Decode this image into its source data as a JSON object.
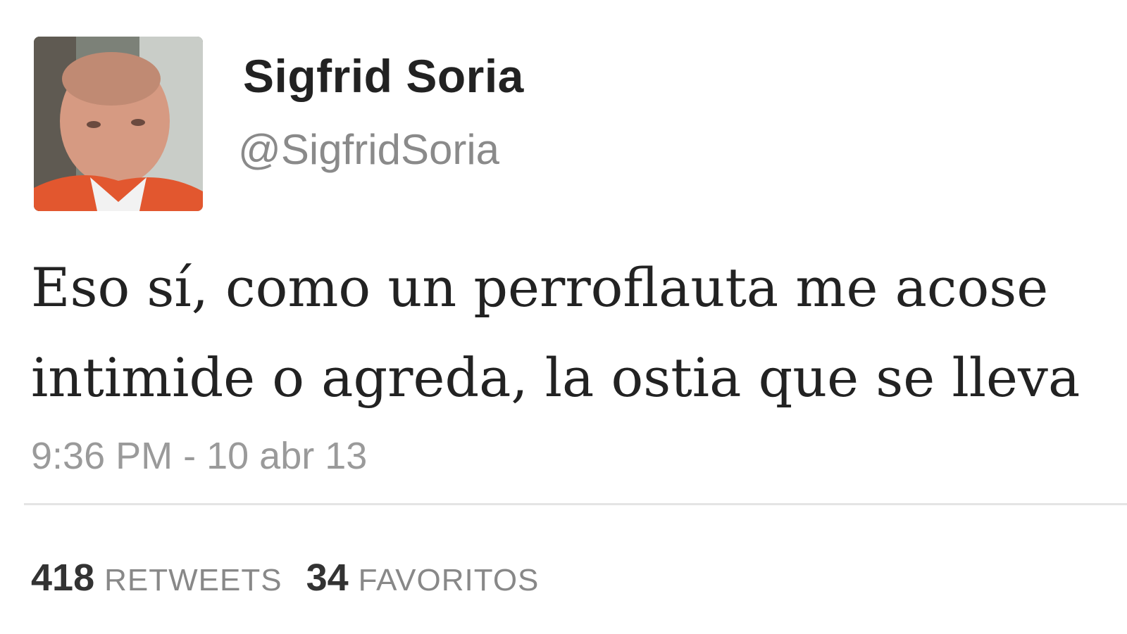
{
  "user": {
    "display_name": "Sigfrid Soria",
    "handle": "@SigfridSoria"
  },
  "tweet": {
    "text_lines": [
      "Eso sí, como un perroflauta me acose",
      "intimide o agreda, la ostia que se lleva"
    ],
    "timestamp": "9:36 PM - 10 abr 13"
  },
  "stats": {
    "retweets": {
      "count": "418",
      "label": "RETWEETS"
    },
    "favorites": {
      "count": "34",
      "label": "FAVORITOS"
    }
  },
  "colors": {
    "name": "#222222",
    "handle": "#8a8a8a",
    "timestamp": "#9a9a9a",
    "divider": "#e4e4e4"
  }
}
